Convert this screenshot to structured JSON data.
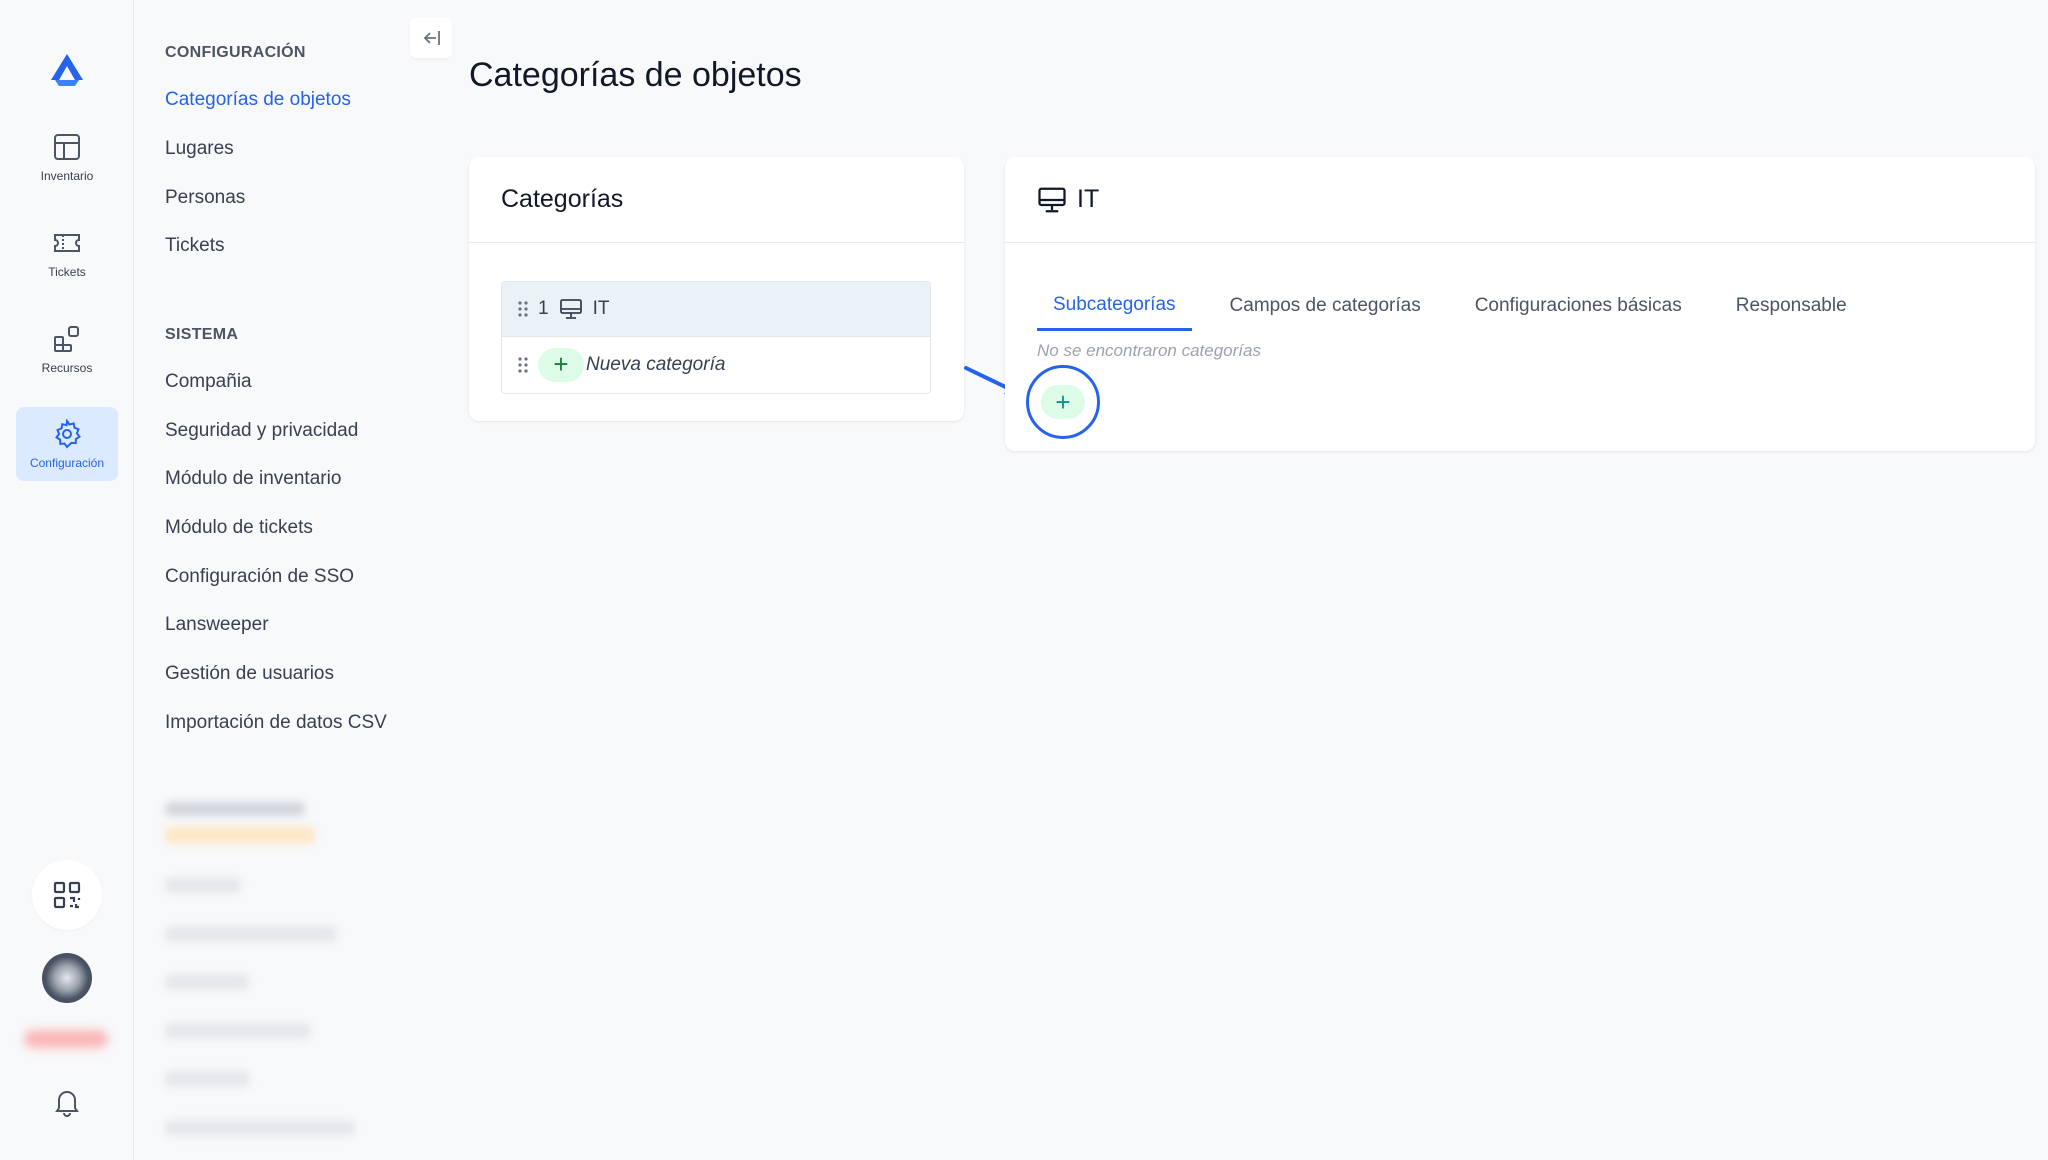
{
  "rail": {
    "items": [
      {
        "label": "Inventario",
        "icon": "table-icon"
      },
      {
        "label": "Tickets",
        "icon": "ticket-icon"
      },
      {
        "label": "Recursos",
        "icon": "resources-icon"
      },
      {
        "label": "Configuración",
        "icon": "gear-icon"
      }
    ],
    "accent": "#2563eb"
  },
  "sidebar": {
    "config_title": "CONFIGURACIÓN",
    "config_items": [
      "Categorías de objetos",
      "Lugares",
      "Personas",
      "Tickets"
    ],
    "system_title": "SISTEMA",
    "system_items": [
      "Compañia",
      "Seguridad y privacidad",
      "Módulo de inventario",
      "Módulo de tickets",
      "Configuración de SSO",
      "Lansweeper",
      "Gestión de usuarios",
      "Importación de datos CSV"
    ]
  },
  "main": {
    "title": "Categorías de objetos",
    "categories_card": {
      "title": "Categorías",
      "items": [
        {
          "index": "1",
          "name": "IT",
          "icon": "monitor-icon"
        }
      ],
      "new_label": "Nueva categoría"
    },
    "detail_card": {
      "title": "IT",
      "icon": "monitor-icon",
      "tabs": [
        "Subcategorías",
        "Campos de categorías",
        "Configuraciones básicas",
        "Responsable"
      ],
      "active_tab": "Subcategorías",
      "empty_message": "No se encontraron categorías",
      "add_label": "+"
    }
  }
}
